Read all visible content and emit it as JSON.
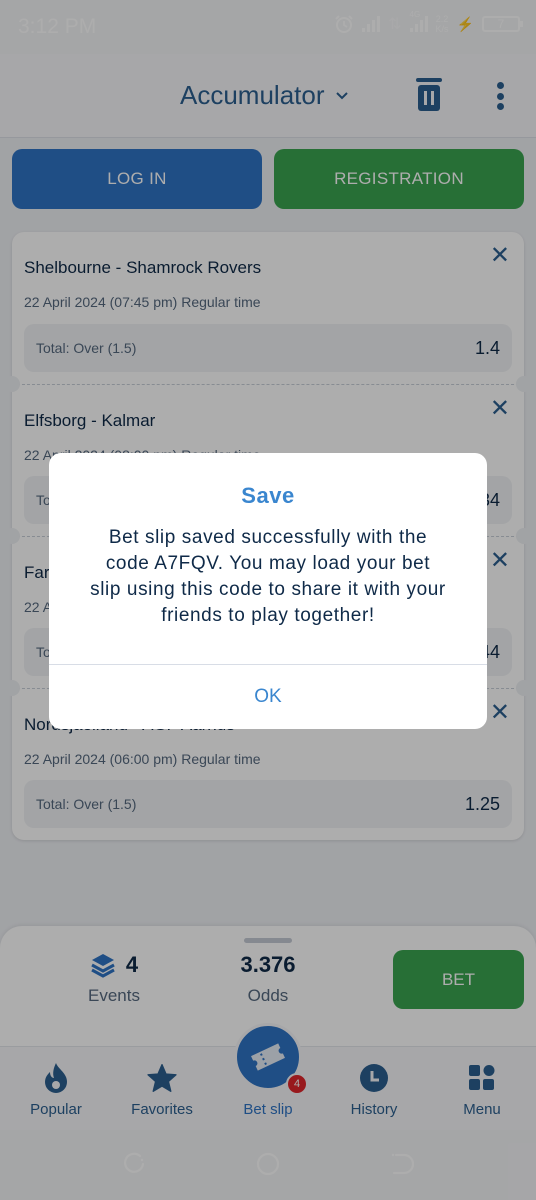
{
  "status_bar": {
    "time": "3:12 PM",
    "network_type": "4G",
    "net_speed_value": "2.2",
    "net_speed_unit": "K/s",
    "battery_level": "7",
    "icons": [
      "alarm-icon",
      "signal-icon",
      "data-arrows-icon",
      "signal-4g-icon",
      "charging-icon",
      "battery-icon"
    ]
  },
  "app_bar": {
    "title": "Accumulator",
    "title_dropdown_icon": "chevron-down-icon",
    "actions": [
      "trash-icon",
      "more-vert-icon"
    ]
  },
  "auth": {
    "login_label": "LOG IN",
    "register_label": "REGISTRATION"
  },
  "events": [
    {
      "match": "Shelbourne - Shamrock Rovers",
      "meta": "22 April 2024 (07:45 pm) Regular time",
      "market": "Total: Over (1.5)",
      "odds": "1.4"
    },
    {
      "match": "Elfsborg - Kalmar",
      "meta": "22 April 2024 (08:00 pm) Regular time",
      "market": "Total: Over (1.5)",
      "odds": "1.34"
    },
    {
      "match": "Far",
      "meta": "22 A",
      "market": "Total: Over (1.5)",
      "odds": "1.44"
    },
    {
      "match": "Nordsjaelland - AGF Aarhus",
      "meta": "22 April 2024 (06:00 pm) Regular time",
      "market": "Total: Over (1.5)",
      "odds": "1.25"
    }
  ],
  "summary": {
    "events_count": "4",
    "events_label": "Events",
    "odds_value": "3.376",
    "odds_label": "Odds",
    "bet_label": "BET"
  },
  "tabs": [
    {
      "label": "Popular",
      "icon": "fire-icon"
    },
    {
      "label": "Favorites",
      "icon": "star-icon"
    },
    {
      "label": "Bet slip",
      "icon": "ticket-icon",
      "badge": "4",
      "active": true
    },
    {
      "label": "History",
      "icon": "clock-icon"
    },
    {
      "label": "Menu",
      "icon": "grid-icon"
    }
  ],
  "dialog": {
    "title": "Save",
    "message": "Bet slip saved successfully with the code A7FQV. You may load your bet slip using this code to share it with your friends to play together!",
    "code": "A7FQV",
    "ok_label": "OK"
  },
  "colors": {
    "primary_blue": "#2f73c4",
    "accent_green": "#3aa450",
    "dialog_accent": "#3a86cf",
    "badge_red": "#e0262b",
    "text_dark": "#0f2a48"
  }
}
